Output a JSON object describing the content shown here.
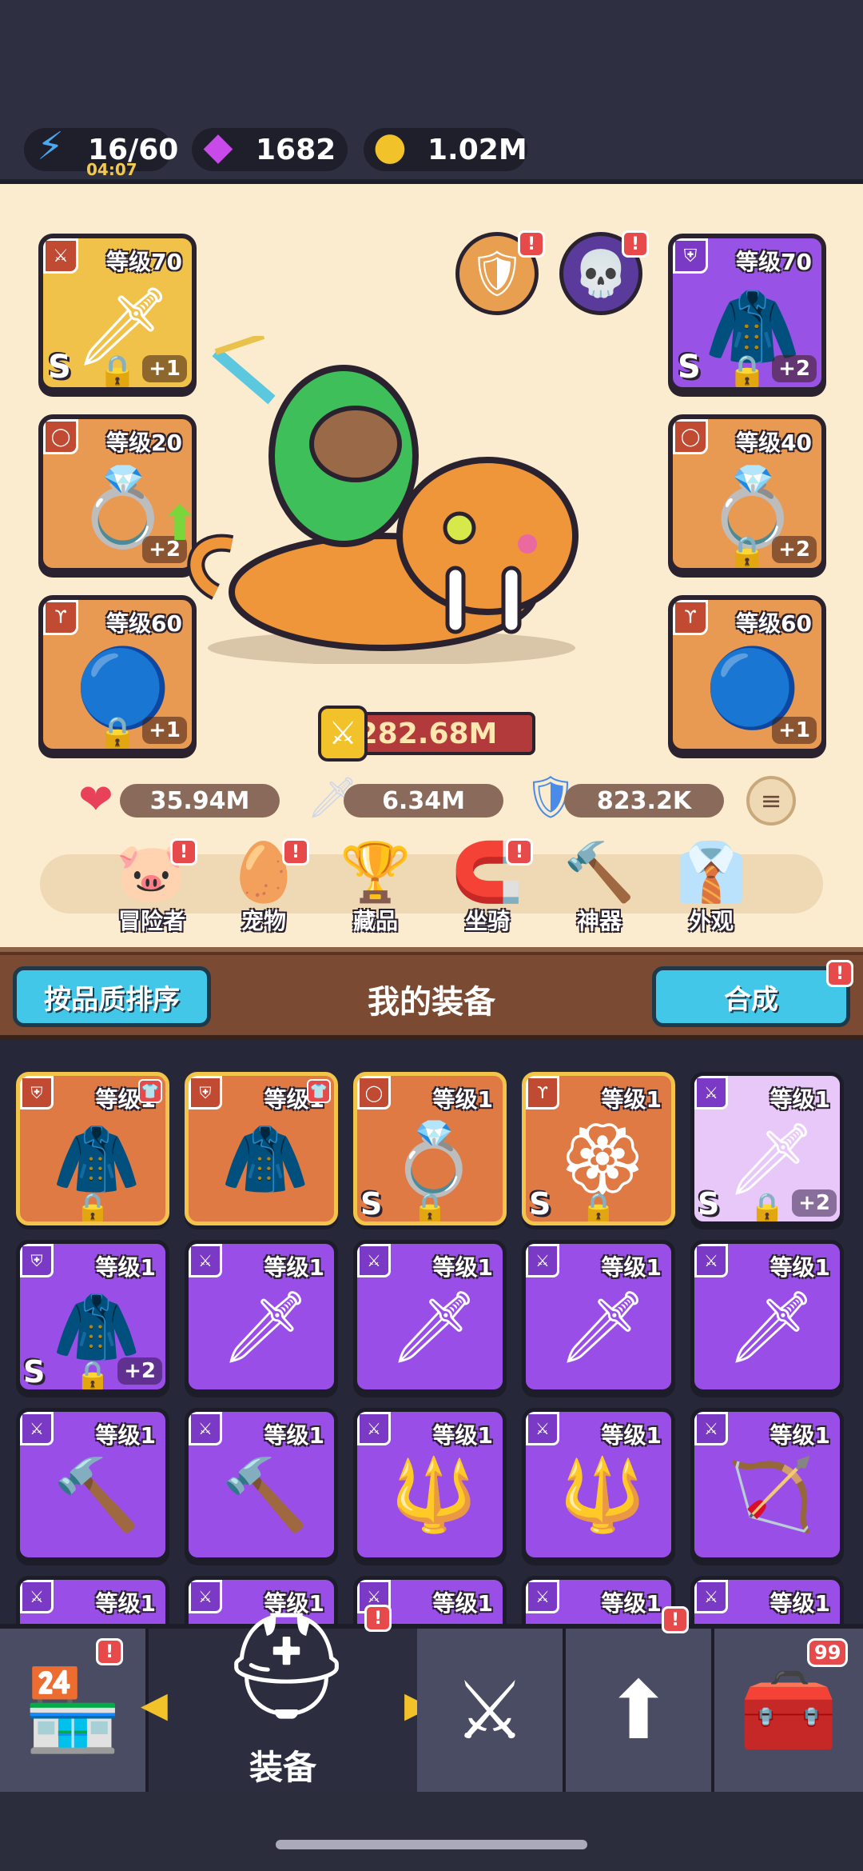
{
  "resources": {
    "energy": "16/60",
    "energy_timer": "04:07",
    "gems": "1682",
    "gold": "1.02M"
  },
  "equip_slots": [
    {
      "level": "等级70",
      "plus": "+1",
      "grade": "S",
      "icon": "sword-icon"
    },
    {
      "level": "等级20",
      "plus": "+2",
      "grade": "",
      "icon": "ring-icon"
    },
    {
      "level": "等级60",
      "plus": "+1",
      "grade": "",
      "icon": "necklace-icon"
    },
    {
      "level": "等级70",
      "plus": "+2",
      "grade": "S",
      "icon": "armor-icon"
    },
    {
      "level": "等级40",
      "plus": "+2",
      "grade": "",
      "icon": "ring-icon"
    },
    {
      "level": "等级60",
      "plus": "+1",
      "grade": "",
      "icon": "necklace-icon"
    }
  ],
  "power": "282.68M",
  "stats": {
    "hp": "35.94M",
    "atk": "6.34M",
    "def": "823.2K"
  },
  "features": [
    "冒险者",
    "宠物",
    "藏品",
    "坐骑",
    "神器",
    "外观"
  ],
  "inventory_header": {
    "sort_label": "按品质排序",
    "title": "我的装备",
    "merge_label": "合成"
  },
  "inventory": [
    "等级1",
    "等级1",
    "等级1",
    "等级1",
    "等级1",
    "等级1",
    "等级1",
    "等级1",
    "等级1",
    "等级1",
    "等级1",
    "等级1",
    "等级1",
    "等级1",
    "等级1",
    "等级1",
    "等级1",
    "等级1",
    "等级1",
    "等级1"
  ],
  "inventory_plus": {
    "four": "+2",
    "five": "+2"
  },
  "grade_s": "S",
  "nav": {
    "equip_label": "装备",
    "chest_count": "99",
    "badge": "!"
  }
}
